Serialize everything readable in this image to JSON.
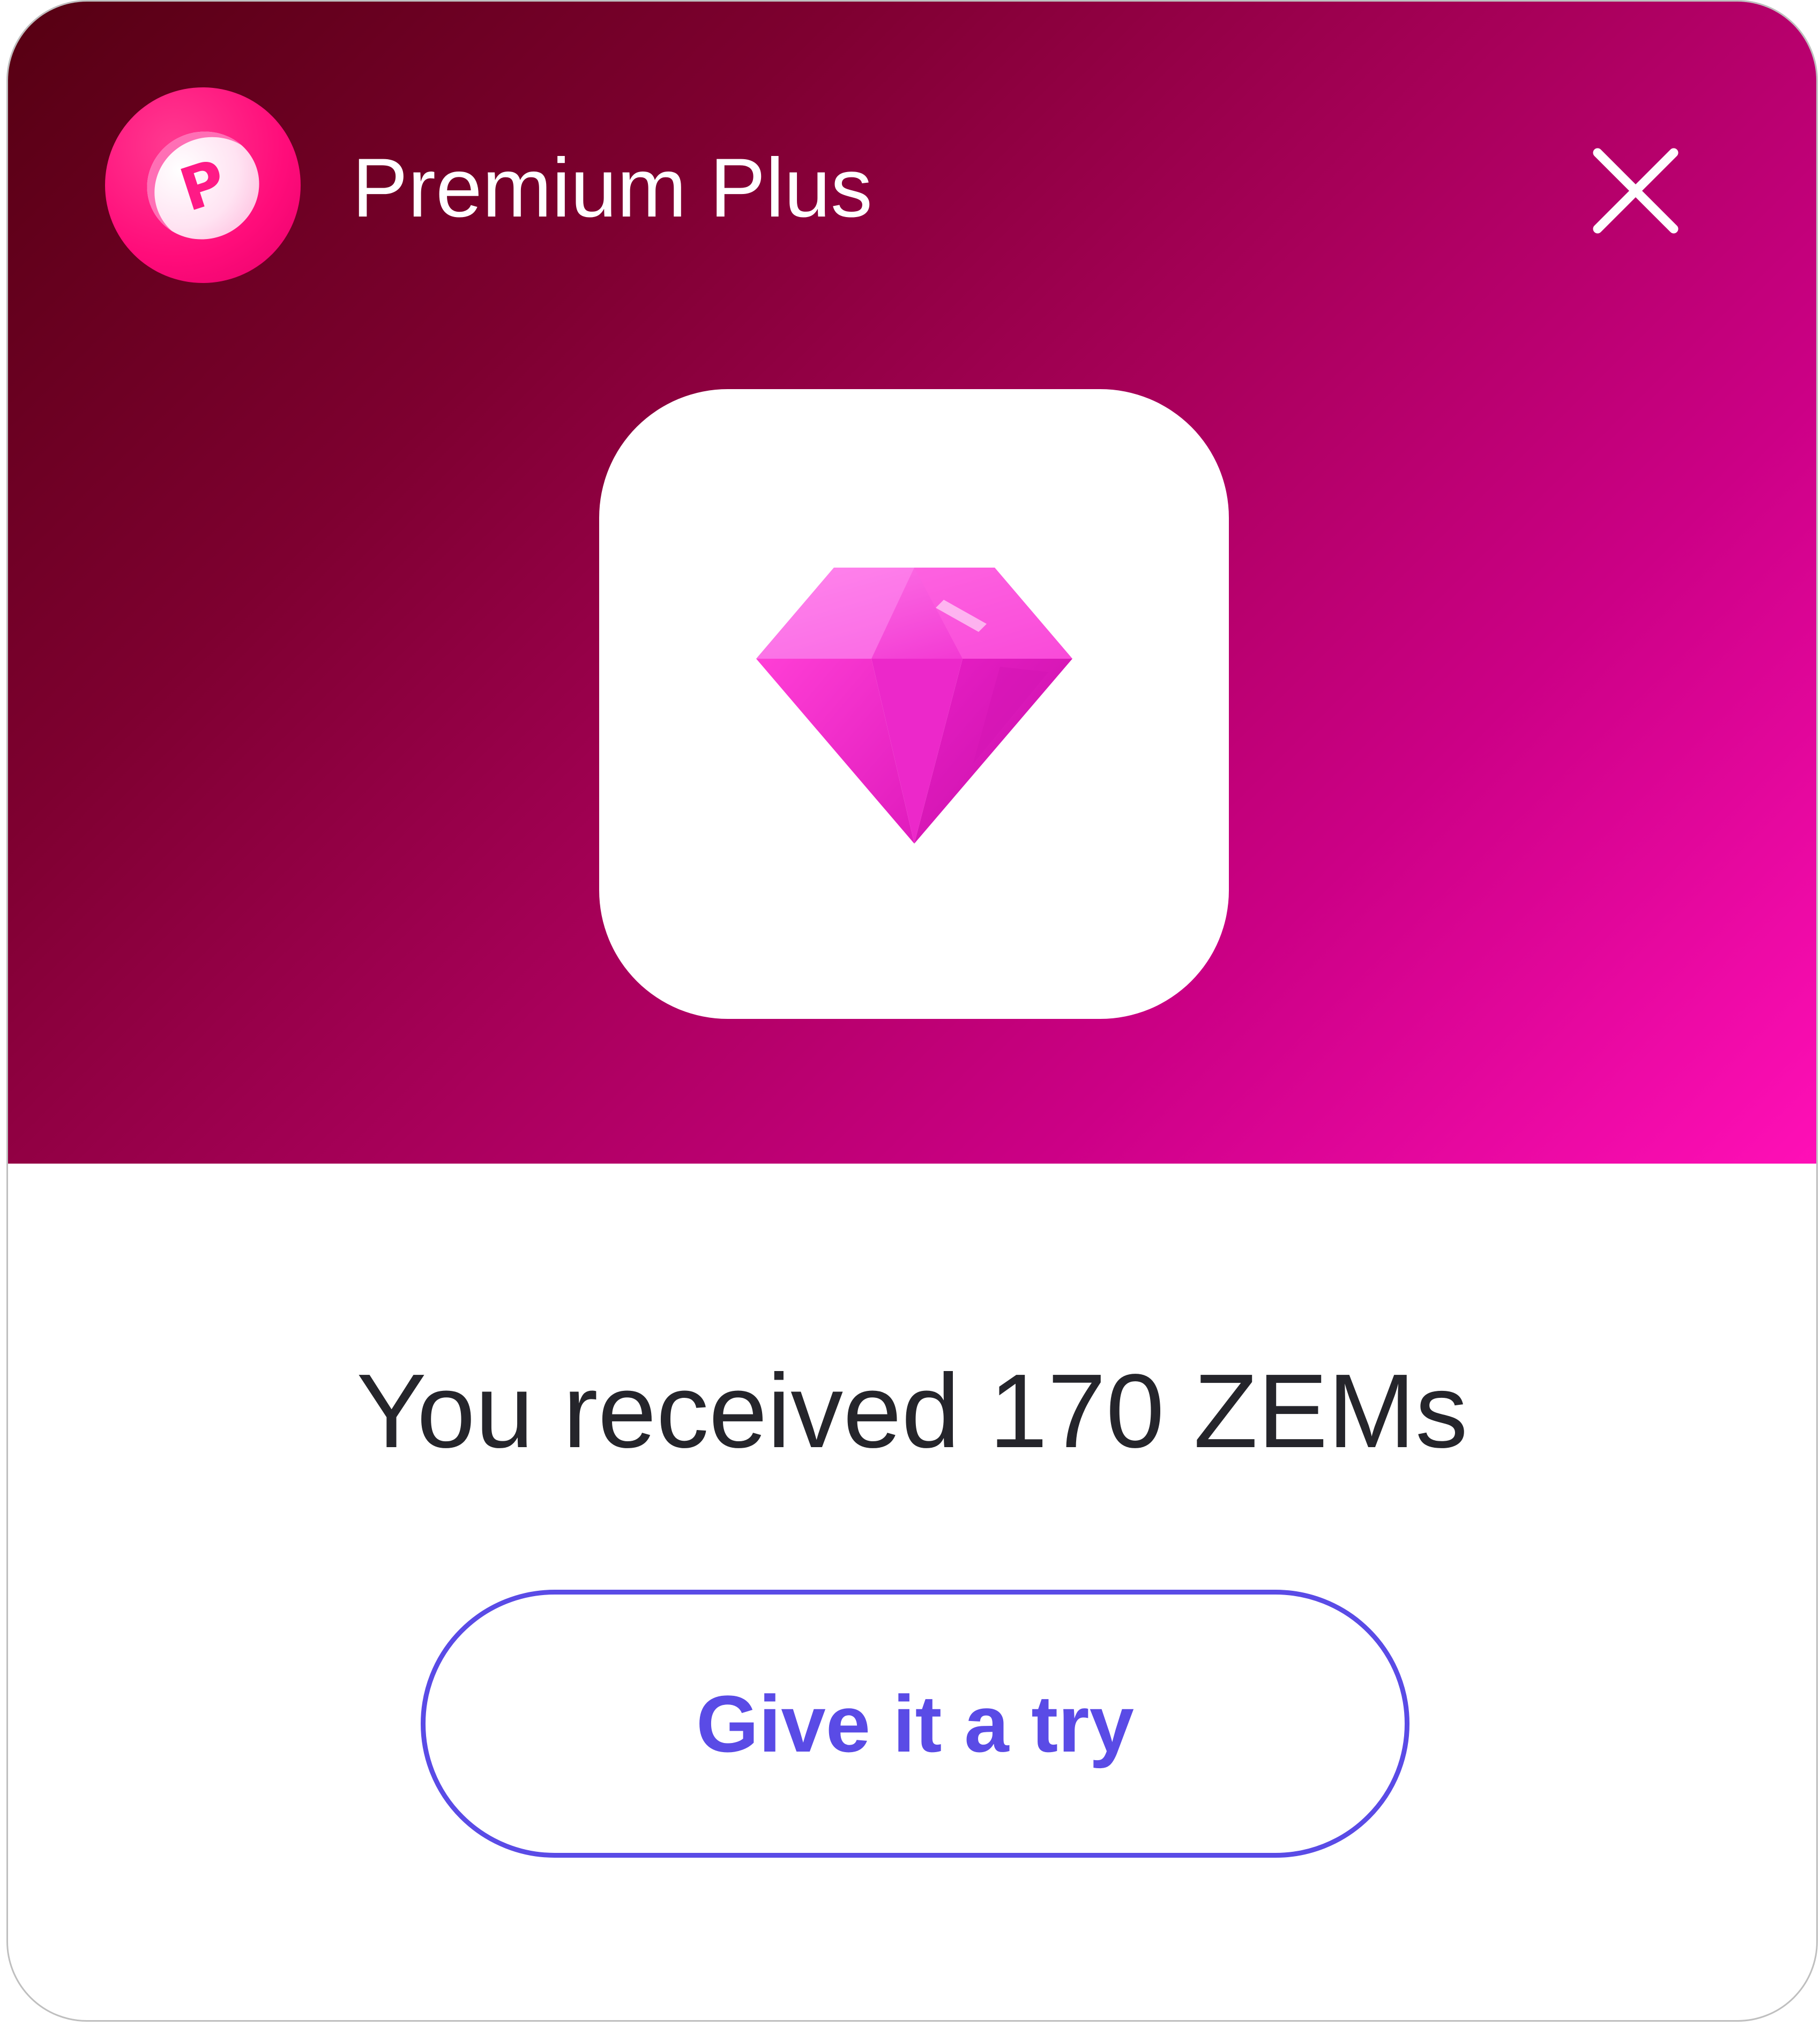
{
  "header": {
    "title": "Premium Plus",
    "logo_icon": "premium-coin-icon",
    "logo_letter": "P",
    "close_icon": "close-icon"
  },
  "hero": {
    "illustration": "diamond-gem-icon"
  },
  "content": {
    "message": "You received 170 ZEMs",
    "cta_label": "Give it a try"
  },
  "colors": {
    "gradient_start": "#560012",
    "gradient_end": "#ff0fb7",
    "gem": "#ff2fc8",
    "cta": "#5a4be6",
    "text": "#25252b"
  }
}
